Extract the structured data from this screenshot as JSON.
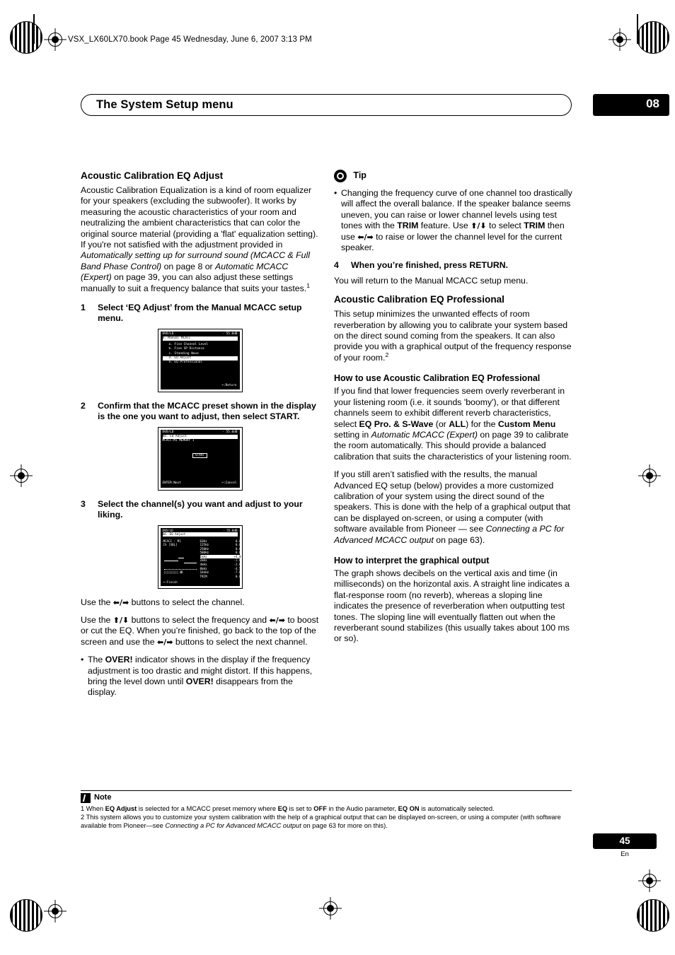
{
  "header": {
    "file_line": "VSX_LX60LX70.book  Page 45  Wednesday, June 6, 2007  3:13 PM",
    "chapter_title": "The System Setup menu",
    "chapter_number": "08"
  },
  "left_column": {
    "heading": "Acoustic Calibration EQ Adjust",
    "intro_a": "Acoustic Calibration Equalization is a kind of room equalizer for your speakers (excluding the subwoofer). It works by measuring the acoustic characteristics of your room and neutralizing the ambient characteristics that can color the original source material (providing a 'flat' equalization setting). If you're not satisfied with the adjustment provided in ",
    "intro_italic1": "Automatically setting up for surround sound (MCACC & Full Band Phase Control)",
    "intro_b": " on page 8 or ",
    "intro_italic2": "Automatic MCACC (Expert)",
    "intro_c": " on page 39, you can also adjust these settings manually to suit a frequency balance that suits your tastes.",
    "intro_sup": "1",
    "step1_num": "1",
    "step1_text": "Select ‘EQ Adjust’ from the Manual MCACC setup menu.",
    "step2_num": "2",
    "step2_text": "Confirm that the MCACC preset shown in the display is the one you want to adjust, then select START.",
    "step3_num": "3",
    "step3_text": "Select the channel(s) you want and adjust to your liking.",
    "after3_a": "Use the ",
    "after3_b": " buttons to select the channel.",
    "after3_c": "Use the ",
    "after3_d": " buttons to select the frequency and ",
    "after3_e": " to boost or cut the EQ. When you’re finished, go back to the top of the screen and use the ",
    "after3_f": " buttons to select the next channel.",
    "bullet_a": "The ",
    "bullet_over1": "OVER!",
    "bullet_b": " indicator shows in the display if the frequency adjustment is too drastic and might distort. If this happens, bring the level down until ",
    "bullet_over2": "OVER!",
    "bullet_c": " disappears from the display."
  },
  "osd1": {
    "title_left": "DVD/LD",
    "title_right": "- 55.0dB",
    "banner": "8. Manual MCACC",
    "lines": [
      "a. Fine Channel Level",
      "b. Fine SP Distance",
      "c. Standing Wave"
    ],
    "selected": "d. EQ Adjust",
    "line_last": "e. EQ Professional",
    "footer_right": "↩:Return"
  },
  "osd2": {
    "title_left": "DVD/LD",
    "title_right": "- 55.0dB",
    "banner": "8d. EQ Adjust",
    "subline": "MCACC:M1 MEMORY 1",
    "button": "START",
    "footer_left": "ENTER:Next",
    "footer_right": "↩:Cancel"
  },
  "osd3": {
    "title_left": "DVD/LD",
    "title_right": "- 55.0dB",
    "banner": "8d. EQ Adjust",
    "rows": [
      {
        "label": "MCACC : M1",
        "freq": "63Hz",
        "val": "0.0"
      },
      {
        "label": "Ch    [SBL]",
        "freq": "125Hz",
        "val": "0.0"
      },
      {
        "label": "",
        "freq": "250Hz",
        "val": "0.0"
      },
      {
        "label": "",
        "freq": "500Hz",
        "val": "0.0"
      },
      {
        "label": "",
        "freq": "1kHz",
        "val": "+4.0"
      },
      {
        "label": "",
        "freq": "2kHz",
        "val": "-1.0"
      },
      {
        "label": "",
        "freq": "4kHz",
        "val": "-2.0"
      },
      {
        "label": "",
        "freq": "8kHz",
        "val": "-4.5"
      },
      {
        "label": "",
        "freq": "16kHz",
        "val": "-7.0"
      },
      {
        "label": "",
        "freq": "TRIM",
        "val": "0.0"
      }
    ],
    "footer_left": "↩:Finish"
  },
  "right_column": {
    "tip_label": "Tip",
    "tip_a": "Changing the frequency curve of one channel too drastically will affect the overall balance. If the speaker balance seems uneven, you can raise or lower channel levels using test tones with the ",
    "tip_trim1": "TRIM",
    "tip_b": " feature. Use ",
    "tip_c": " to select ",
    "tip_trim2": "TRIM",
    "tip_d": " then use ",
    "tip_e": " to raise or lower the channel level for the current speaker.",
    "step4_num": "4",
    "step4_text": "When you’re finished, press RETURN.",
    "step4_after": "You will return to the Manual MCACC setup menu.",
    "heading2": "Acoustic Calibration EQ Professional",
    "para2_a": "This setup minimizes the unwanted effects of room reverberation by allowing you to calibrate your system based on the direct sound coming from the speakers. It can also provide you with a graphical output of the frequency response of your room.",
    "para2_sup": "2",
    "sub1": "How to use Acoustic Calibration EQ Professional",
    "sub1_a": "If you find that lower frequencies seem overly reverberant in your listening room (i.e. it sounds 'boomy'), or that different channels seem to exhibit different reverb characteristics, select ",
    "sub1_eqpro": "EQ Pro. & S-Wave",
    "sub1_b": " (or ",
    "sub1_all": "ALL",
    "sub1_c": ") for the ",
    "sub1_custom": "Custom Menu",
    "sub1_d": " setting in ",
    "sub1_italic": "Automatic MCACC (Expert)",
    "sub1_e": " on page 39 to calibrate the room automatically. This should provide a balanced calibration that suits the characteristics of your listening room.",
    "sub1_f": "If you still aren’t satisfied with the results, the manual Advanced EQ setup (below) provides a more customized calibration of your system using the direct sound of the speakers. This is done with the help of a graphical output that can be displayed on-screen, or using a computer (with software available from Pioneer — see ",
    "sub1_italic2": "Connecting a PC for Advanced MCACC output",
    "sub1_g": " on page 63).",
    "sub2": "How to interpret the graphical output",
    "sub2_text": "The graph shows decibels on the vertical axis and time (in milliseconds) on the horizontal axis. A straight line indicates a flat-response room (no reverb), whereas a sloping line indicates the presence of reverberation when outputting test tones. The sloping line will eventually flatten out when the reverberant sound stabilizes (this usually takes about 100 ms or so)."
  },
  "footer": {
    "note_label": "Note",
    "note1_a": "1 When ",
    "note1_eqadjust": "EQ Adjust",
    "note1_b": " is selected for a MCACC preset memory where ",
    "note1_eq": "EQ",
    "note1_c": " is set to ",
    "note1_off": "OFF",
    "note1_d": " in the Audio parameter, ",
    "note1_eqon": "EQ ON",
    "note1_e": " is automatically selected.",
    "note2_a": "2 This system allows you to customize your system calibration with the help of a graphical output that can be displayed on-screen, or using a computer (with software available from Pioneer—see ",
    "note2_italic": "Connecting a PC for Advanced MCACC output",
    "note2_b": " on page 63 for more on this).",
    "page_number": "45",
    "lang": "En"
  }
}
